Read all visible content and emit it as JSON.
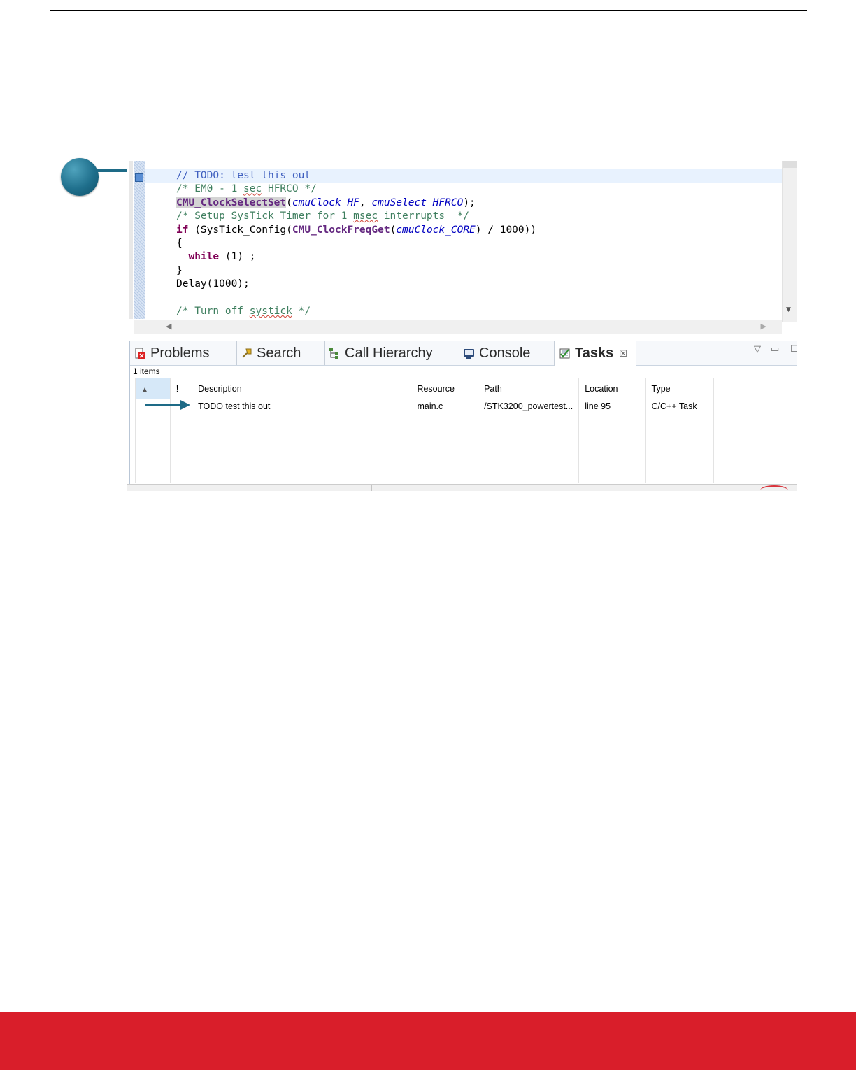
{
  "editor": {
    "lines": [
      [
        {
          "t": "// TODO: test this out",
          "c": "c-comment-dark"
        }
      ],
      [
        {
          "t": "/* EM0 - 1 ",
          "c": "c-comment"
        },
        {
          "t": "sec",
          "c": "c-comment squiggle"
        },
        {
          "t": " HFRCO */",
          "c": "c-comment"
        }
      ],
      [
        {
          "t": "CMU_ClockSelectSet",
          "c": "c-fn-hl"
        },
        {
          "t": "(",
          "c": ""
        },
        {
          "t": "cmuClock_HF",
          "c": "c-param"
        },
        {
          "t": ", ",
          "c": ""
        },
        {
          "t": "cmuSelect_HFRCO",
          "c": "c-param"
        },
        {
          "t": ");",
          "c": ""
        }
      ],
      [
        {
          "t": "/* Setup SysTick Timer for 1 ",
          "c": "c-comment"
        },
        {
          "t": "msec",
          "c": "c-comment squiggle"
        },
        {
          "t": " interrupts  */",
          "c": "c-comment"
        }
      ],
      [
        {
          "t": "if",
          "c": "c-kw"
        },
        {
          "t": " (SysTick_Config(",
          "c": ""
        },
        {
          "t": "CMU_ClockFreqGet",
          "c": "c-fn"
        },
        {
          "t": "(",
          "c": ""
        },
        {
          "t": "cmuClock_CORE",
          "c": "c-param"
        },
        {
          "t": ") / 1000))",
          "c": ""
        }
      ],
      [
        {
          "t": "{",
          "c": ""
        }
      ],
      [
        {
          "t": "  ",
          "c": ""
        },
        {
          "t": "while",
          "c": "c-kw"
        },
        {
          "t": " (1) ;",
          "c": ""
        }
      ],
      [
        {
          "t": "}",
          "c": ""
        }
      ],
      [
        {
          "t": "Delay(1000);",
          "c": ""
        }
      ],
      [
        {
          "t": "",
          "c": ""
        }
      ],
      [
        {
          "t": "/* Turn off ",
          "c": "c-comment"
        },
        {
          "t": "systick",
          "c": "c-comment squiggle"
        },
        {
          "t": " */",
          "c": "c-comment"
        }
      ]
    ]
  },
  "panel": {
    "tabs": [
      {
        "label": "Problems",
        "icon": "problems-icon"
      },
      {
        "label": "Search",
        "icon": "search-icon"
      },
      {
        "label": "Call Hierarchy",
        "icon": "call-hierarchy-icon"
      },
      {
        "label": "Console",
        "icon": "console-icon"
      },
      {
        "label": "Tasks",
        "icon": "tasks-icon",
        "active": true
      }
    ],
    "close_glyph": "☒",
    "items_count": "1 items",
    "columns": [
      "",
      "!",
      "Description",
      "Resource",
      "Path",
      "Location",
      "Type",
      ""
    ],
    "rows": [
      [
        "",
        "",
        "TODO test this out",
        "main.c",
        "/STK3200_powertest...",
        "line 95",
        "C/C++ Task",
        ""
      ]
    ]
  },
  "colors": {
    "footer_red": "#d91e2a",
    "callout_teal": "#1e6b87"
  }
}
